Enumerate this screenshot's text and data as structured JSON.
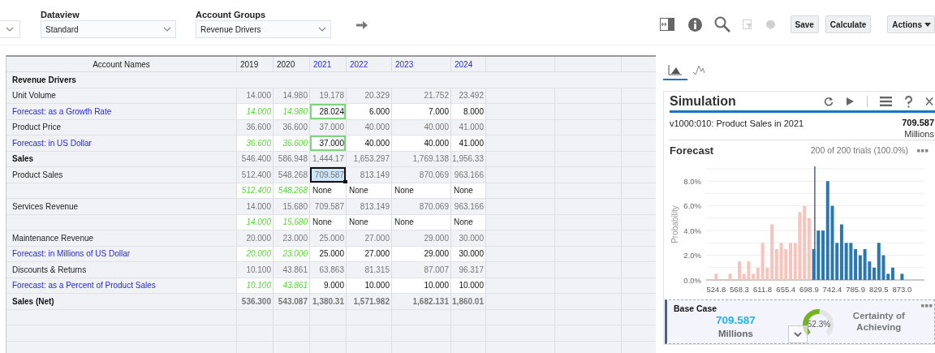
{
  "filters": [
    {
      "label": "Dataview",
      "value": "Standard"
    },
    {
      "label": "Account Groups",
      "value": "Revenue Drivers"
    }
  ],
  "toolbar": {
    "tools": [
      {
        "kind": "resize",
        "disabled": false
      },
      {
        "kind": "info",
        "disabled": false
      },
      {
        "kind": "search",
        "disabled": false
      },
      {
        "kind": "filter",
        "disabled": true
      },
      {
        "kind": "brain",
        "disabled": true
      }
    ],
    "buttons": [
      "Save",
      "Calculate"
    ],
    "menu": "Actions"
  },
  "table": {
    "row_header_title": "Account Names",
    "columns": [
      {
        "label": "2019",
        "forecast": false
      },
      {
        "label": "2020",
        "forecast": false
      },
      {
        "label": "2021",
        "forecast": true
      },
      {
        "label": "2022",
        "forecast": true
      },
      {
        "label": "2023",
        "forecast": true
      },
      {
        "label": "2024",
        "forecast": true
      }
    ],
    "rows": [
      {
        "kind": "group",
        "name": "Revenue Drivers",
        "cells": []
      },
      {
        "kind": "base",
        "name": "Unit Volume",
        "cells": [
          {
            "text": "14.000",
            "selected": false,
            "outlined": false
          },
          {
            "text": "14.980",
            "selected": false,
            "outlined": false
          },
          {
            "text": "19.178",
            "selected": false,
            "outlined": false
          },
          {
            "text": "20.329",
            "selected": false,
            "outlined": false
          },
          {
            "text": "21.752",
            "selected": false,
            "outlined": false
          },
          {
            "text": "23.492",
            "selected": false,
            "outlined": false
          }
        ]
      },
      {
        "kind": "forecast",
        "name": "Forecast: as a Growth Rate",
        "cells": [
          {
            "text": "14.000",
            "selected": false,
            "outlined": false
          },
          {
            "text": "14.980",
            "selected": false,
            "outlined": false
          },
          {
            "text": "28.024",
            "selected": false,
            "outlined": true
          },
          {
            "text": "6.000",
            "selected": false,
            "outlined": false
          },
          {
            "text": "7.000",
            "selected": false,
            "outlined": false
          },
          {
            "text": "8.000",
            "selected": false,
            "outlined": false
          }
        ]
      },
      {
        "kind": "base",
        "name": "Product Price",
        "cells": [
          {
            "text": "36.600",
            "selected": false,
            "outlined": false
          },
          {
            "text": "36.600",
            "selected": false,
            "outlined": false
          },
          {
            "text": "37.000",
            "selected": false,
            "outlined": false
          },
          {
            "text": "40.000",
            "selected": false,
            "outlined": false
          },
          {
            "text": "40.000",
            "selected": false,
            "outlined": false
          },
          {
            "text": "41.000",
            "selected": false,
            "outlined": false
          }
        ]
      },
      {
        "kind": "forecast",
        "name": "Forecast: in US Dollar",
        "cells": [
          {
            "text": "36.600",
            "selected": false,
            "outlined": false
          },
          {
            "text": "36.600",
            "selected": false,
            "outlined": false
          },
          {
            "text": "37.000",
            "selected": false,
            "outlined": true
          },
          {
            "text": "40.000",
            "selected": false,
            "outlined": false
          },
          {
            "text": "40.000",
            "selected": false,
            "outlined": false
          },
          {
            "text": "41.000",
            "selected": false,
            "outlined": false
          }
        ]
      },
      {
        "kind": "subtotal",
        "name": "Sales",
        "cells": [
          {
            "text": "546.400",
            "selected": false,
            "outlined": false
          },
          {
            "text": "586.948",
            "selected": false,
            "outlined": false
          },
          {
            "text": "1,444.17",
            "selected": false,
            "outlined": false
          },
          {
            "text": "1,653.297",
            "selected": false,
            "outlined": false
          },
          {
            "text": "1,769.138",
            "selected": false,
            "outlined": false
          },
          {
            "text": "1,956.33",
            "selected": false,
            "outlined": false
          }
        ]
      },
      {
        "kind": "base",
        "name": "Product Sales",
        "cells": [
          {
            "text": "512.400",
            "selected": false,
            "outlined": false
          },
          {
            "text": "548.268",
            "selected": false,
            "outlined": false
          },
          {
            "text": "709.587",
            "selected": true,
            "outlined": false
          },
          {
            "text": "813.149",
            "selected": false,
            "outlined": false
          },
          {
            "text": "870.069",
            "selected": false,
            "outlined": false
          },
          {
            "text": "963.166",
            "selected": false,
            "outlined": false
          }
        ]
      },
      {
        "kind": "result",
        "cells": [
          {
            "text": "512.400",
            "selected": false,
            "outlined": false
          },
          {
            "text": "548.268",
            "selected": false,
            "outlined": false
          },
          {
            "text": "None",
            "selected": false,
            "outlined": false
          },
          {
            "text": "None",
            "selected": false,
            "outlined": false
          },
          {
            "text": "None",
            "selected": false,
            "outlined": false
          },
          {
            "text": "None",
            "selected": false,
            "outlined": false
          }
        ]
      },
      {
        "kind": "base",
        "name": "Services Revenue",
        "cells": [
          {
            "text": "14.000",
            "selected": false,
            "outlined": false
          },
          {
            "text": "15.680",
            "selected": false,
            "outlined": false
          },
          {
            "text": "709.587",
            "selected": false,
            "outlined": false
          },
          {
            "text": "813.149",
            "selected": false,
            "outlined": false
          },
          {
            "text": "870.069",
            "selected": false,
            "outlined": false
          },
          {
            "text": "963.166",
            "selected": false,
            "outlined": false
          }
        ]
      },
      {
        "kind": "result",
        "cells": [
          {
            "text": "14.000",
            "selected": false,
            "outlined": false
          },
          {
            "text": "15.680",
            "selected": false,
            "outlined": false
          },
          {
            "text": "None",
            "selected": false,
            "outlined": false
          },
          {
            "text": "None",
            "selected": false,
            "outlined": false
          },
          {
            "text": "None",
            "selected": false,
            "outlined": false
          },
          {
            "text": "None",
            "selected": false,
            "outlined": false
          }
        ]
      },
      {
        "kind": "base",
        "name": "Maintenance Revenue",
        "cells": [
          {
            "text": "20.000",
            "selected": false,
            "outlined": false
          },
          {
            "text": "23.000",
            "selected": false,
            "outlined": false
          },
          {
            "text": "25.000",
            "selected": false,
            "outlined": false
          },
          {
            "text": "27.000",
            "selected": false,
            "outlined": false
          },
          {
            "text": "29.000",
            "selected": false,
            "outlined": false
          },
          {
            "text": "30.000",
            "selected": false,
            "outlined": false
          }
        ]
      },
      {
        "kind": "forecast",
        "name": "Forecast: in Millions of US Dollar",
        "cells": [
          {
            "text": "20.000",
            "selected": false,
            "outlined": false
          },
          {
            "text": "23.000",
            "selected": false,
            "outlined": false
          },
          {
            "text": "25.000",
            "selected": false,
            "outlined": false
          },
          {
            "text": "27.000",
            "selected": false,
            "outlined": false
          },
          {
            "text": "29.000",
            "selected": false,
            "outlined": false
          },
          {
            "text": "30.000",
            "selected": false,
            "outlined": false
          }
        ]
      },
      {
        "kind": "base",
        "name": "Discounts & Returns",
        "cells": [
          {
            "text": "10.100",
            "selected": false,
            "outlined": false
          },
          {
            "text": "43.861",
            "selected": false,
            "outlined": false
          },
          {
            "text": "63.863",
            "selected": false,
            "outlined": false
          },
          {
            "text": "81.315",
            "selected": false,
            "outlined": false
          },
          {
            "text": "87.007",
            "selected": false,
            "outlined": false
          },
          {
            "text": "96.317",
            "selected": false,
            "outlined": false
          }
        ]
      },
      {
        "kind": "forecast",
        "name": "Forecast: as a Percent of Product Sales",
        "cells": [
          {
            "text": "10.100",
            "selected": false,
            "outlined": false
          },
          {
            "text": "43.861",
            "selected": false,
            "outlined": false
          },
          {
            "text": "9.000",
            "selected": false,
            "outlined": false
          },
          {
            "text": "10.000",
            "selected": false,
            "outlined": false
          },
          {
            "text": "10.000",
            "selected": false,
            "outlined": false
          },
          {
            "text": "10.000",
            "selected": false,
            "outlined": false
          }
        ]
      },
      {
        "kind": "total",
        "name": "Sales (Net)",
        "cells": [
          {
            "text": "536.300",
            "selected": false,
            "outlined": false
          },
          {
            "text": "543.087",
            "selected": false,
            "outlined": false
          },
          {
            "text": "1,380.31",
            "selected": false,
            "outlined": false
          },
          {
            "text": "1,571.982",
            "selected": false,
            "outlined": false
          },
          {
            "text": "1,682.131",
            "selected": false,
            "outlined": false
          },
          {
            "text": "1,860.01",
            "selected": false,
            "outlined": false
          }
        ]
      }
    ]
  },
  "panel_tabs": [
    {
      "kind": "histogram",
      "selected": true
    },
    {
      "kind": "curve",
      "selected": false
    }
  ],
  "simulation": {
    "title": "Simulation",
    "target": "v1000:010: Product Sales in 2021",
    "value": "709.587",
    "unit": "Millions",
    "forecast": {
      "title": "Forecast",
      "trials": "200 of 200 trials (100.0%)",
      "chart_data": {
        "type": "bar",
        "ylabel": "Probability",
        "xlim": [
          506.0,
          915.0
        ],
        "ylim": [
          0,
          9
        ],
        "grid": true,
        "x": [
          524.8,
          533.5,
          542.2,
          550.9,
          559.6,
          568.3,
          577.0,
          585.7,
          594.4,
          603.1,
          611.8,
          620.5,
          629.3,
          638.0,
          646.7,
          655.4,
          664.1,
          672.8,
          681.5,
          690.2,
          698.9,
          707.6,
          716.3,
          725.0,
          733.7,
          742.4,
          751.1,
          759.8,
          768.5,
          777.2,
          785.9,
          794.7,
          803.4,
          812.1,
          820.8,
          829.5,
          838.2,
          846.9,
          855.6,
          864.3,
          873.0
        ],
        "series": [
          {
            "color": "#f7c3bb",
            "values": [
              0.5,
              0,
              0,
              0.5,
              0,
              1.5,
              0.5,
              1.5,
              0.5,
              1.0,
              3.0,
              1.0,
              4.5,
              2.5,
              3.0,
              2.5,
              3.0,
              3.0,
              5.5,
              6.0,
              5.0,
              null,
              null,
              null,
              null,
              null,
              null,
              null,
              null,
              null,
              null,
              null,
              null,
              null,
              null,
              null,
              null,
              null,
              null,
              null,
              null
            ]
          },
          {
            "color": "#2a78b2",
            "values": [
              null,
              null,
              null,
              null,
              null,
              null,
              null,
              null,
              null,
              null,
              null,
              null,
              null,
              null,
              null,
              null,
              null,
              null,
              null,
              null,
              null,
              2.5,
              4.0,
              4.0,
              8.0,
              6.0,
              3.0,
              4.5,
              3.0,
              3.0,
              2.5,
              2.0,
              2.5,
              1.5,
              1.0,
              3.0,
              2.0,
              0.5,
              1.0,
              0,
              0.5
            ]
          }
        ],
        "xticks": [
          {
            "value": 524.8,
            "label": "524.8"
          },
          {
            "value": 568.3,
            "label": "568.3"
          },
          {
            "value": 611.8,
            "label": "611.8"
          },
          {
            "value": 655.4,
            "label": "655.4"
          },
          {
            "value": 698.9,
            "label": "698.9"
          },
          {
            "value": 742.4,
            "label": "742.4"
          },
          {
            "value": 785.9,
            "label": "785.9"
          },
          {
            "value": 829.5,
            "label": "829.5"
          },
          {
            "value": 873.0,
            "label": "873.0"
          }
        ],
        "yticks": [
          {
            "value": 0,
            "label": "0.0%"
          },
          {
            "value": 2,
            "label": "2.0%"
          },
          {
            "value": 4,
            "label": "4.0%"
          },
          {
            "value": 6,
            "label": "6.0%"
          },
          {
            "value": 8,
            "label": "8.0%"
          }
        ],
        "ref_lines": [
          {
            "axis": "x",
            "value": 709.587
          }
        ]
      }
    },
    "base_case": {
      "title": "Base Case",
      "value": "709.587",
      "unit": "Millions",
      "certainty": {
        "level": 0.523,
        "reading": "52.3%"
      },
      "caption": "Certainty of Achieving"
    }
  }
}
